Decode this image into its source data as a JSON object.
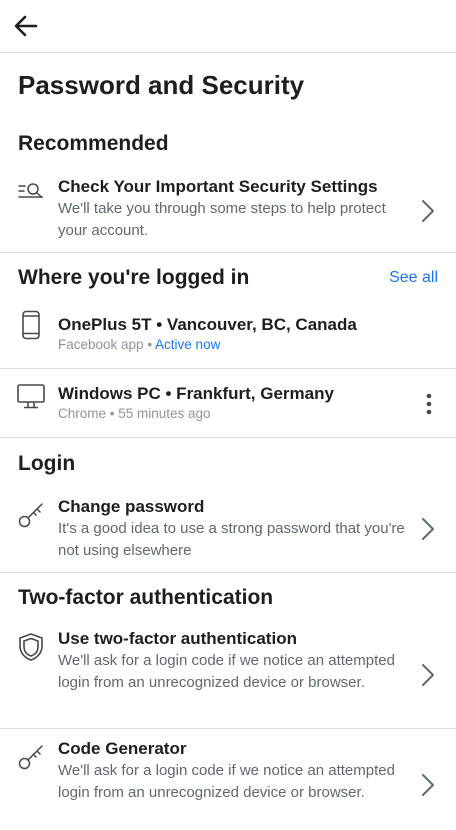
{
  "header": {
    "back_icon": "arrow-left-icon"
  },
  "page": {
    "title": "Password and Security"
  },
  "recommended": {
    "heading": "Recommended",
    "item": {
      "icon": "search-list-icon",
      "title": "Check Your Important Security Settings",
      "subtitle": "We'll take you through some steps to help protect your account."
    }
  },
  "logged_in": {
    "heading": "Where you're logged in",
    "see_all": "See all",
    "devices": [
      {
        "icon": "phone-icon",
        "title": "OnePlus 5T • Vancouver, BC, Canada",
        "app": "Facebook app",
        "sep": " • ",
        "status": "Active now"
      },
      {
        "icon": "desktop-icon",
        "title": "Windows PC • Frankfurt, Germany",
        "app": "Chrome",
        "sep": " • ",
        "status": "55 minutes ago"
      }
    ]
  },
  "login": {
    "heading": "Login",
    "item": {
      "icon": "key-icon",
      "title": "Change password",
      "subtitle": "It's a good idea to use a strong password that you're not using elsewhere"
    }
  },
  "two_factor": {
    "heading": "Two-factor authentication",
    "items": [
      {
        "icon": "shield-icon",
        "title": "Use two-factor authentication",
        "subtitle": "We'll ask for a login code if we notice an attempted login from an unrecognized device or browser."
      },
      {
        "icon": "key-icon",
        "title": "Code Generator",
        "subtitle": "We'll ask for a login code if we notice an attempted login from an unrecognized device or browser."
      }
    ]
  },
  "colors": {
    "accent": "#1877f2",
    "text": "#1c1e21",
    "secondary": "#606770",
    "divider": "#dadde1"
  }
}
